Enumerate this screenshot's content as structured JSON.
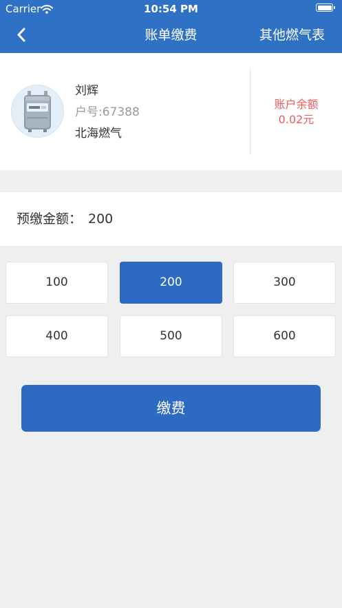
{
  "status_bar": {
    "carrier": "Carrier",
    "time": "10:54 PM"
  },
  "nav": {
    "title": "账单缴费",
    "right_action": "其他燃气表"
  },
  "account": {
    "name": "刘辉",
    "account_no": "户号:67388",
    "company": "北海燃气",
    "balance_label": "账户余额",
    "balance_value": "0.02元"
  },
  "prepay": {
    "label": "预缴金额：",
    "value": "200"
  },
  "amount_options": [
    {
      "label": "100",
      "selected": false
    },
    {
      "label": "200",
      "selected": true
    },
    {
      "label": "300",
      "selected": false
    },
    {
      "label": "400",
      "selected": false
    },
    {
      "label": "500",
      "selected": false
    },
    {
      "label": "600",
      "selected": false
    }
  ],
  "pay_button": {
    "label": "缴费"
  },
  "colors": {
    "primary": "#2c6bc1",
    "nav_bar": "#2f72c5",
    "balance_text": "#f05a5a",
    "background": "#efefef"
  }
}
